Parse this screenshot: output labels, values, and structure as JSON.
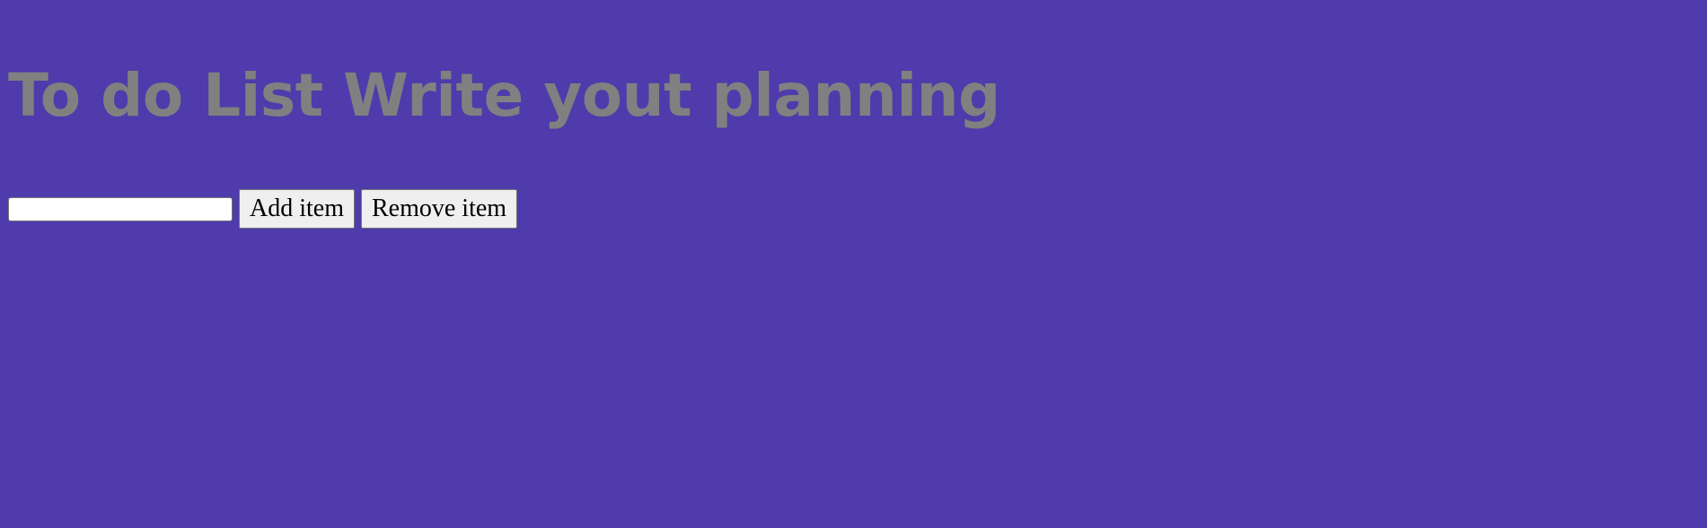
{
  "page": {
    "title": "To do List Write yout planning",
    "background_color": "#4f3bab",
    "title_color": "#808080"
  },
  "form": {
    "input_value": "",
    "input_placeholder": "",
    "add_label": "Add item",
    "remove_label": "Remove item"
  }
}
